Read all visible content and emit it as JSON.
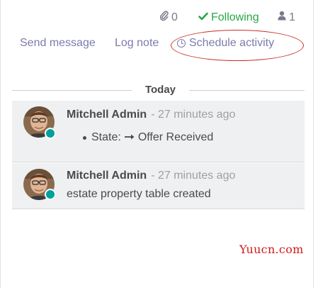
{
  "topbar": {
    "attachments_count": "0",
    "following_label": "Following",
    "followers_count": "1",
    "icons": {
      "attachments": "paperclip-icon",
      "following": "check-icon",
      "followers": "user-icon"
    }
  },
  "actions": {
    "send_message": "Send message",
    "log_note": "Log note",
    "schedule_activity": "Schedule activity"
  },
  "separator": {
    "label": "Today"
  },
  "messages": [
    {
      "author": "Mitchell Admin",
      "date": "- 27 minutes ago",
      "tracking": {
        "field": "State:",
        "new_value": "Offer Received"
      }
    },
    {
      "author": "Mitchell Admin",
      "date": "- 27 minutes ago",
      "body": "estate property table created"
    }
  ],
  "watermark": "Yuucn.com",
  "colors": {
    "accent": "#7c7bad",
    "following_green": "#28a745",
    "presence_online": "#00a09d",
    "annotation_red": "#c8302a",
    "watermark_red": "#d11b1b"
  }
}
